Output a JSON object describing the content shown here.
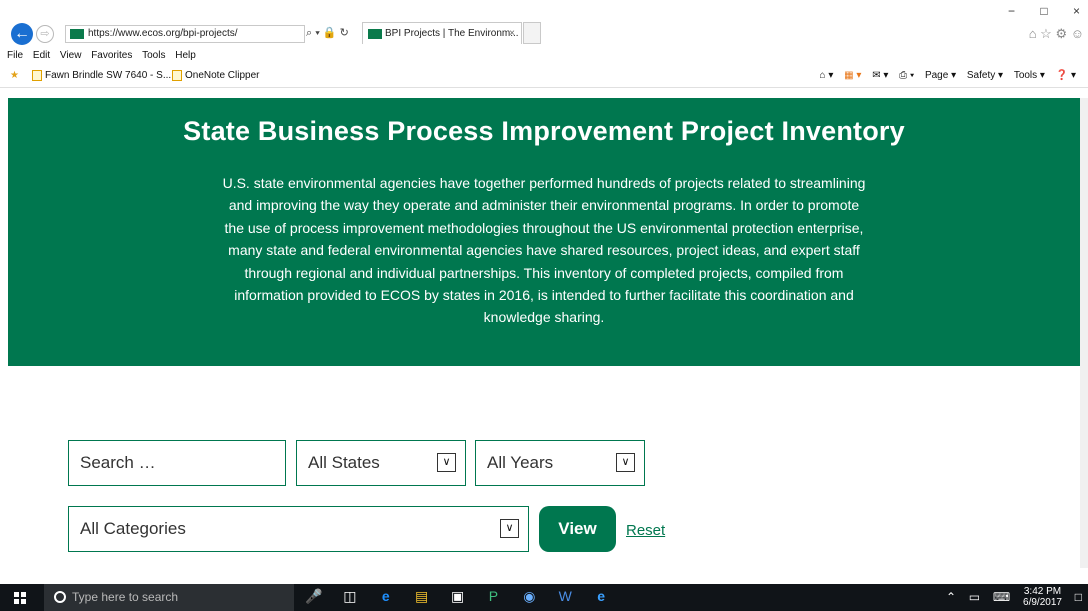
{
  "browser": {
    "address_url": "https://www.ecos.org/bpi-projects/",
    "address_tools": "⌕ ▾ 🔒 ↻",
    "tab_title": "BPI Projects | The Environm...",
    "tab_close": "×",
    "back_glyph": "←",
    "forward_glyph": "⇨",
    "window_controls": [
      "−",
      "□",
      "×"
    ],
    "right_icons": "⌂ ☆ ⚙ ☺",
    "menu": [
      "File",
      "Edit",
      "View",
      "Favorites",
      "Tools",
      "Help"
    ],
    "favorites": [
      "Fawn Brindle SW 7640 - S...",
      "OneNote Clipper"
    ],
    "command_bar": [
      "Page ▾",
      "Safety ▾",
      "Tools ▾",
      "❓ ▾"
    ]
  },
  "header": {
    "title": "State Business Process Improvement Project Inventory",
    "description": "U.S. state environmental agencies have together performed hundreds of projects related to streamlining and improving the way they operate and administer their environmental programs. In order to promote the use of process improvement methodologies throughout the US environmental protection enterprise, many state and federal environmental agencies have shared resources, project ideas, and expert staff through regional and individual partnerships. This inventory of completed projects, compiled from information provided to ECOS by states in 2016, is intended to further facilitate this coordination and knowledge sharing."
  },
  "filters": {
    "search_placeholder": "Search …",
    "states_selected": "All States",
    "years_selected": "All Years",
    "categories_selected": "All Categories",
    "dropdown_glyph": "∨",
    "view_label": "View",
    "reset_label": "Reset"
  },
  "taskbar": {
    "search_placeholder": "Type here to search",
    "time": "3:42 PM",
    "date": "6/9/2017"
  },
  "colors": {
    "brand_green": "#00774f",
    "taskbar": "#101418"
  }
}
